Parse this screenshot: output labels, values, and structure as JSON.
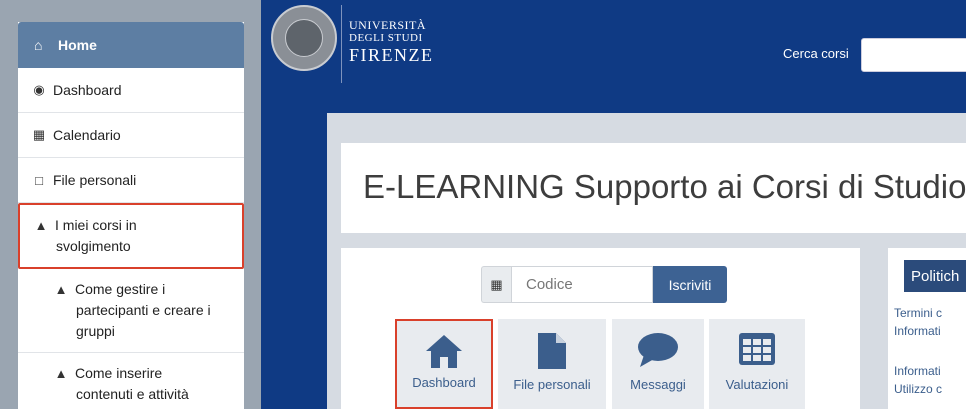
{
  "sidebar": {
    "home": "Home",
    "items": [
      {
        "label": "Dashboard",
        "icon": "tachometer-icon"
      },
      {
        "label": "Calendario",
        "icon": "calendar-icon"
      },
      {
        "label": "File personali",
        "icon": "file-icon"
      },
      {
        "label_line1": "I miei corsi in",
        "label_line2": "svolgimento",
        "icon": "graduation-cap-icon"
      },
      {
        "line1": "Come gestire i",
        "line2": "partecipanti e creare i",
        "line3": "gruppi",
        "icon": "graduation-cap-icon"
      },
      {
        "line1": "Come inserire",
        "line2": "contenuti e attività",
        "icon": "graduation-cap-icon"
      }
    ]
  },
  "header": {
    "university_line1": "UNIVERSITÀ",
    "university_line2": "DEGLI STUDI",
    "university_line3": "FIRENZE",
    "search_label": "Cerca corsi",
    "search_value": ""
  },
  "page": {
    "title": "E-LEARNING Supporto ai Corsi di Studio"
  },
  "enroll": {
    "placeholder": "Codice",
    "button": "Iscriviti"
  },
  "tiles": [
    {
      "label": "Dashboard",
      "icon": "home-icon"
    },
    {
      "label": "File personali",
      "icon": "file-icon"
    },
    {
      "label": "Messaggi",
      "icon": "chat-bubble-icon"
    },
    {
      "label": "Valutazioni",
      "icon": "table-grid-icon"
    }
  ],
  "policy": {
    "heading": "Politich",
    "links": [
      "Termini c",
      "Informati",
      "Informati",
      "Utilizzo c"
    ]
  },
  "colors": {
    "header_bg": "#0f3a84",
    "sidebar_active": "#5d7ea3",
    "accent_button": "#3d6293",
    "highlight_red": "#d9402b"
  }
}
